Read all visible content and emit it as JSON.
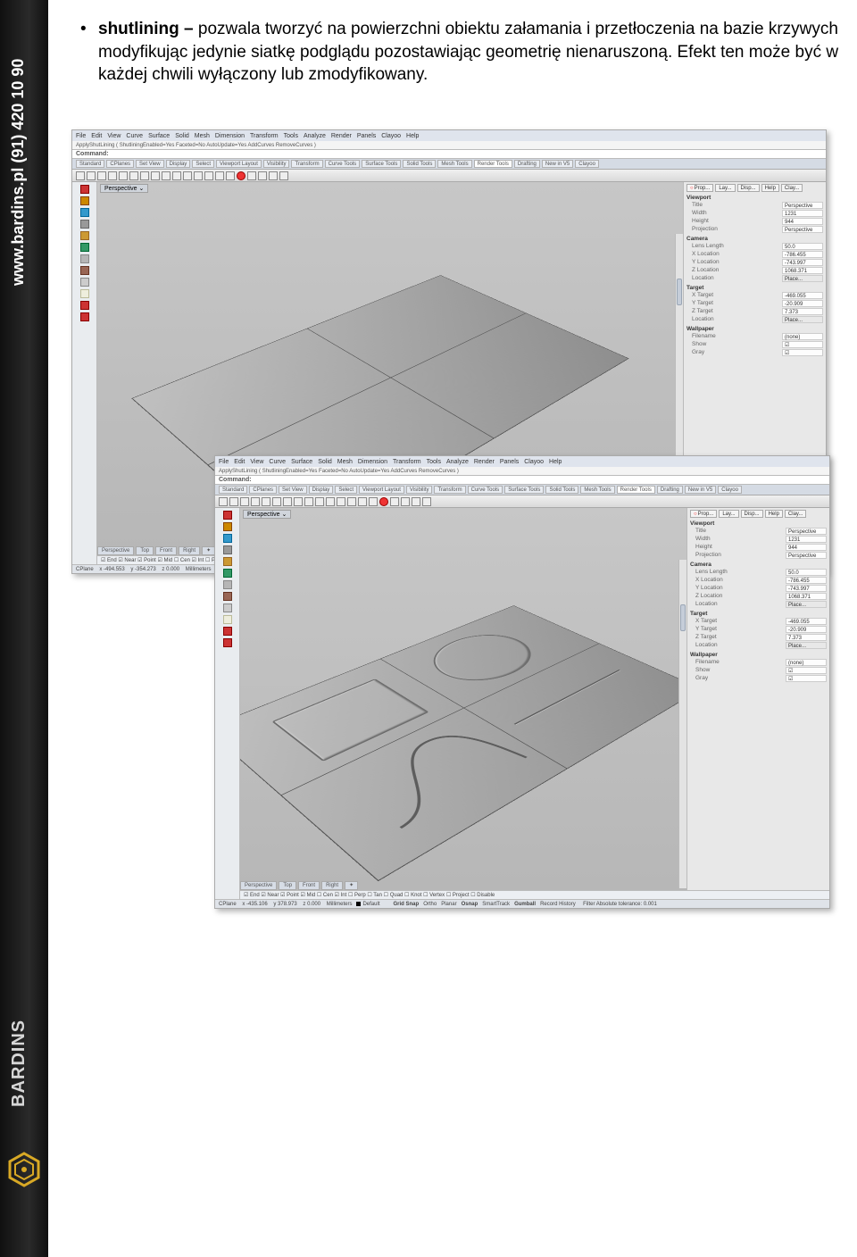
{
  "sidebar": {
    "contact": "www.bardins.pl  (91) 420 10 90",
    "brand": "BARDINS"
  },
  "para": {
    "term": "shutlining – ",
    "body": "pozwala tworzyć na powierzchni obiektu załamania i przetłoczenia na bazie krzywych modyfikując jedynie siatkę podglądu pozostawiając geometrię nienaruszoną. Efekt ten może być w każdej chwili wyłączony lub zmodyfikowany."
  },
  "menus": [
    "File",
    "Edit",
    "View",
    "Curve",
    "Surface",
    "Solid",
    "Mesh",
    "Dimension",
    "Transform",
    "Tools",
    "Analyze",
    "Render",
    "Panels",
    "Clayoo",
    "Help"
  ],
  "cmd_history": "ApplyShutLining ( ShutliningEnabled=Yes Faceted=No AutoUpdate=Yes AddCurves RemoveCurves )",
  "cmd_label": "Command:",
  "tooltabs": [
    "Standard",
    "CPlanes",
    "Set View",
    "Display",
    "Select",
    "Viewport Layout",
    "Visibility",
    "Transform",
    "Curve Tools",
    "Surface Tools",
    "Solid Tools",
    "Mesh Tools",
    "Render Tools",
    "Drafting",
    "New in V5",
    "Clayoo"
  ],
  "active_tooltab": "Render Tools",
  "vp_label": "Perspective",
  "panel_tabs": [
    "Prop...",
    "Lay...",
    "Disp...",
    "Help",
    "Clay..."
  ],
  "panel": {
    "sec_viewport": "Viewport",
    "title_k": "Title",
    "title_v": "Perspective",
    "width_k": "Width",
    "width_v": "1231",
    "height_k": "Height",
    "height_v": "944",
    "proj_k": "Projection",
    "proj_v": "Perspective",
    "sec_camera": "Camera",
    "lens_k": "Lens Length",
    "lens_v": "50.0",
    "xloc_k": "X Location",
    "xloc_v": "-786.455",
    "yloc_k": "Y Location",
    "yloc_v": "-743.997",
    "zloc_k": "Z Location",
    "zloc_v": "1068.371",
    "loc_k": "Location",
    "loc_v": "Place...",
    "sec_target": "Target",
    "xt_k": "X Target",
    "xt_v": "-469.055",
    "yt_k": "Y Target",
    "yt_v": "-20.909",
    "zt_k": "Z Target",
    "zt_v": "7.373",
    "tloc_k": "Location",
    "tloc_v": "Place...",
    "sec_wall": "Wallpaper",
    "file_k": "Filename",
    "file_v": "(none)",
    "show_k": "Show",
    "gray_k": "Gray"
  },
  "view_tabs": [
    "Perspective",
    "Top",
    "Front",
    "Right",
    "✦"
  ],
  "osnapA": "☑ End ☑ Near ☑ Point ☑ Mid ☐ Cen ☑ Int ☐ Perp ☐ Tan ☐ Q",
  "osnapB": "☑ End ☑ Near ☑ Point ☑ Mid ☐ Cen ☑ Int ☐ Perp ☐ Tan ☐ Quad ☐ Knot ☐ Vertex ☐ Project ☐ Disable",
  "statusA": {
    "plane": "CPlane",
    "x": "x -494.553",
    "y": "y -354.273",
    "z": "z 0.000",
    "units": "Millimeters"
  },
  "statusB": {
    "plane": "CPlane",
    "x": "x -435.106",
    "y": "y 378.973",
    "z": "z 0.000",
    "units": "Millimeters",
    "def": "Default",
    "items": [
      "Grid Snap",
      "Ortho",
      "Planar",
      "Osnap",
      "SmartTrack",
      "Gumball",
      "Record History"
    ],
    "filter": "Filter  Absolute tolerance: 0.001"
  }
}
